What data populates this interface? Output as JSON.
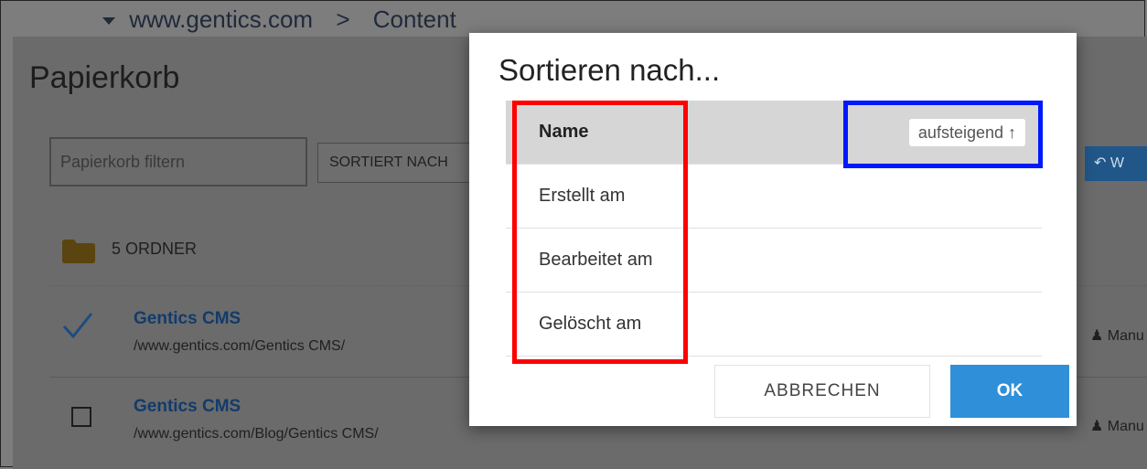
{
  "breadcrumb": {
    "site": "www.gentics.com",
    "separator": ">",
    "current": "Content"
  },
  "page": {
    "title": "Papierkorb"
  },
  "filter": {
    "placeholder": "Papierkorb filtern",
    "value": ""
  },
  "sort_button": {
    "label": "SORTIERT NACH"
  },
  "restore_button": {
    "label": "W"
  },
  "folders": {
    "label": "5 ORDNER"
  },
  "items": [
    {
      "title": "Gentics CMS",
      "path": "/www.gentics.com/Gentics CMS/",
      "selected": true,
      "user": "Manu"
    },
    {
      "title": "Gentics CMS",
      "path": "/www.gentics.com/Blog/Gentics CMS/",
      "selected": false,
      "user": "Manu"
    }
  ],
  "modal": {
    "title": "Sortieren nach...",
    "options": [
      {
        "label": "Name",
        "active": true,
        "order": "aufsteigend ↑"
      },
      {
        "label": "Erstellt am"
      },
      {
        "label": "Bearbeitet am"
      },
      {
        "label": "Gelöscht am"
      }
    ],
    "cancel_label": "ABBRECHEN",
    "ok_label": "OK"
  },
  "colors": {
    "ok_button": "#2f8fd8",
    "highlight_red": "#ff0000",
    "highlight_blue": "#0018ff",
    "link": "#133b6b"
  }
}
